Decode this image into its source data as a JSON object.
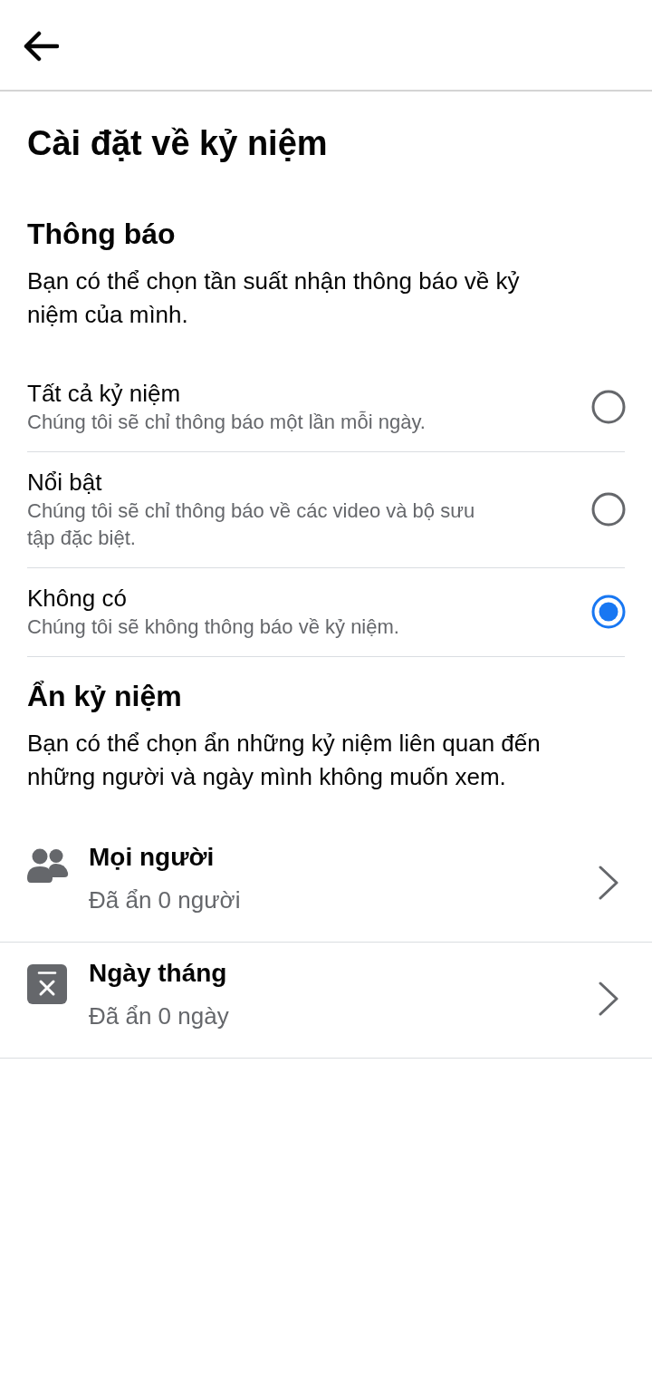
{
  "title": "Cài đặt về kỷ niệm",
  "notifications": {
    "heading": "Thông báo",
    "description": "Bạn có thể chọn tần suất nhận thông báo về kỷ niệm của mình.",
    "options": [
      {
        "label": "Tất cả kỷ niệm",
        "description": "Chúng tôi sẽ chỉ thông báo một lần mỗi ngày.",
        "selected": false
      },
      {
        "label": "Nổi bật",
        "description": "Chúng tôi sẽ chỉ thông báo về các video và bộ sưu tập đặc biệt.",
        "selected": false
      },
      {
        "label": "Không có",
        "description": "Chúng tôi sẽ không thông báo về kỷ niệm.",
        "selected": true
      }
    ]
  },
  "hide": {
    "heading": "Ẩn kỷ niệm",
    "description": "Bạn có thể chọn ẩn những kỷ niệm liên quan đến những người và ngày mình không muốn xem.",
    "items": [
      {
        "kind": "people",
        "label": "Mọi người",
        "summary": "Đã ẩn 0 người"
      },
      {
        "kind": "dates",
        "label": "Ngày tháng",
        "summary": "Đã ẩn 0 ngày"
      }
    ]
  }
}
